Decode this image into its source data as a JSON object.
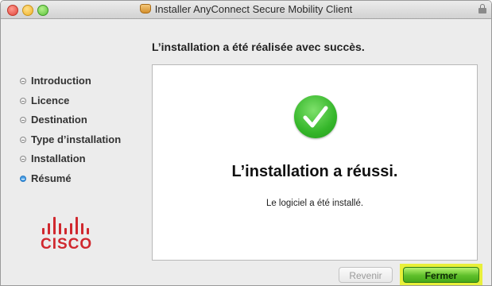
{
  "window": {
    "title": "Installer AnyConnect Secure Mobility Client"
  },
  "heading": "L’installation a été réalisée avec succès.",
  "steps": [
    {
      "label": "Introduction"
    },
    {
      "label": "Licence"
    },
    {
      "label": "Destination"
    },
    {
      "label": "Type d’installation"
    },
    {
      "label": "Installation"
    },
    {
      "label": "Résumé",
      "current": true
    }
  ],
  "logo": {
    "text": "CISCO"
  },
  "panel": {
    "title": "L’installation a réussi.",
    "subtitle": "Le logiciel a été installé."
  },
  "buttons": {
    "back": "Revenir",
    "close": "Fermer"
  },
  "colors": {
    "success": "#35b62a",
    "cisco_red": "#d0282e",
    "highlight": "#e8f03a",
    "current_step": "#4aa0e6"
  },
  "icons": {
    "package": "package-icon",
    "lock": "lock-icon",
    "success": "checkmark-circle-icon"
  }
}
